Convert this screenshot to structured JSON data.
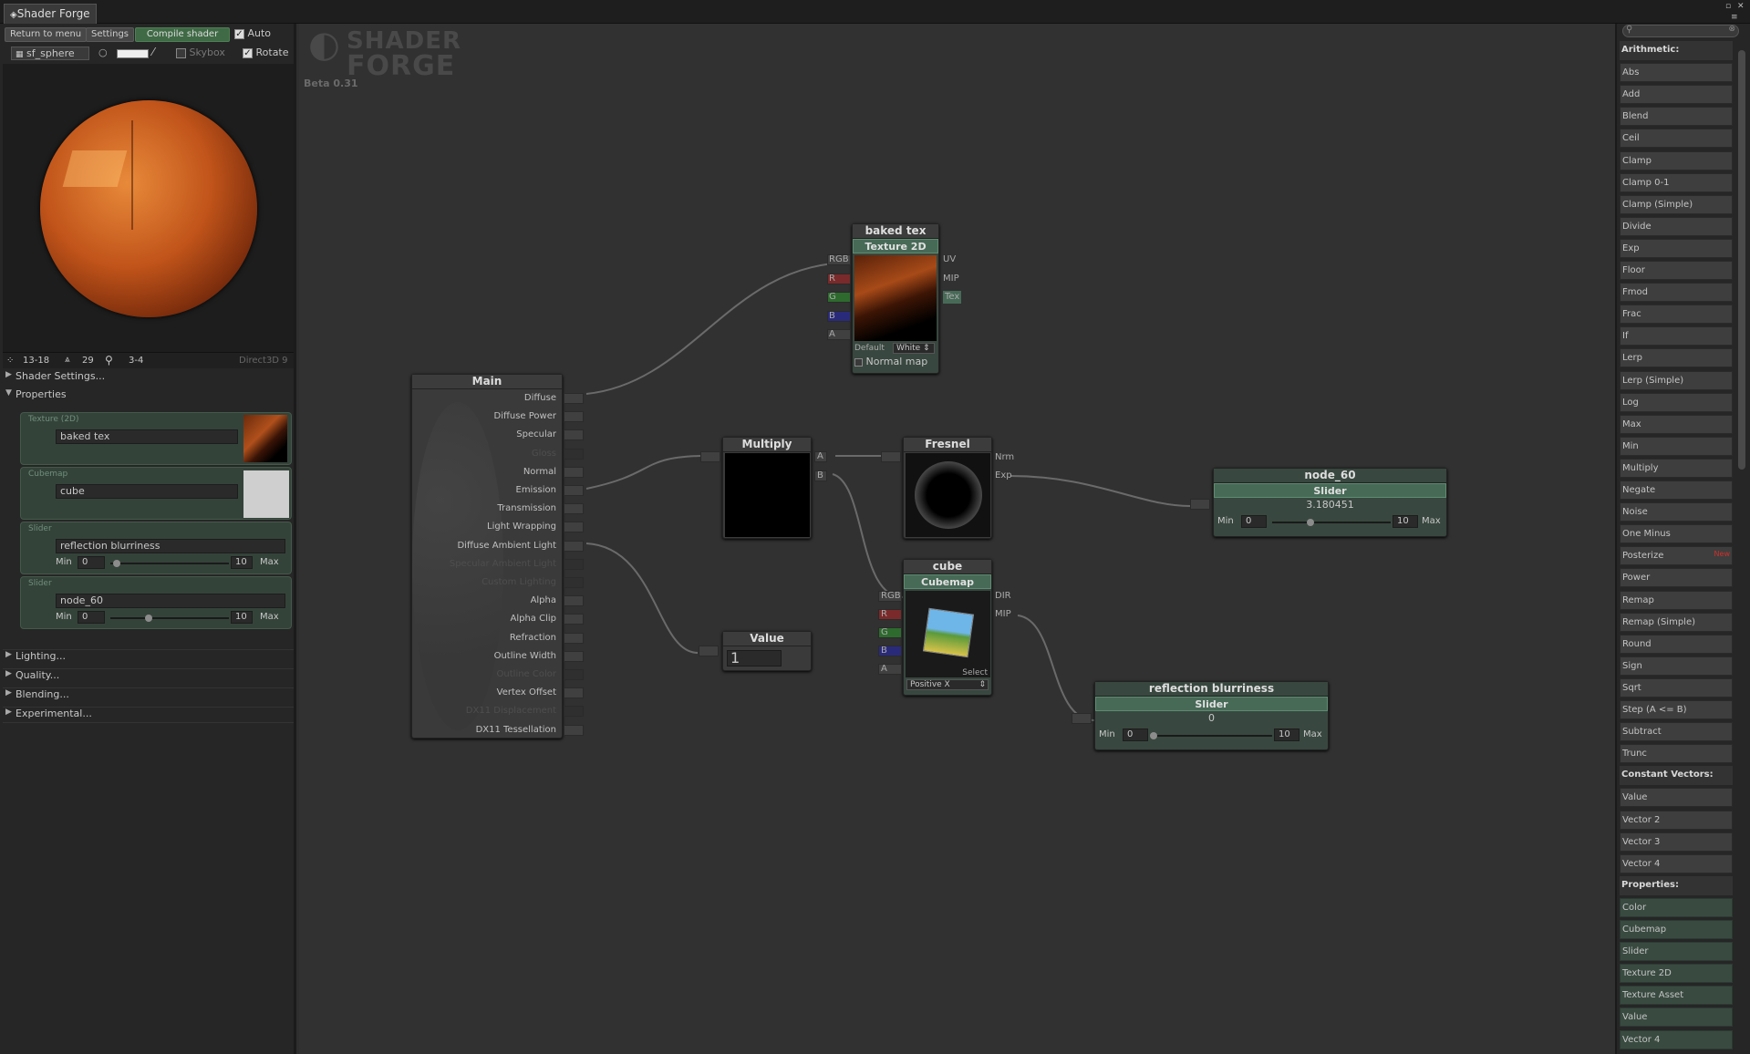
{
  "window": {
    "title": "Shader Forge"
  },
  "toolbar": {
    "return_label": "Return to menu",
    "settings_label": "Settings",
    "compile_label": "Compile shader",
    "auto_label": "Auto",
    "mesh_label": "sf_sphere",
    "skybox_label": "Skybox",
    "rotate_label": "Rotate"
  },
  "stats": {
    "verts": "13-18",
    "tris": "29",
    "passes": "3-4",
    "renderer": "Direct3D 9"
  },
  "left_sections": {
    "shader_settings": "Shader Settings...",
    "properties": "Properties",
    "lighting": "Lighting...",
    "quality": "Quality...",
    "blending": "Blending...",
    "experimental": "Experimental..."
  },
  "properties": [
    {
      "type": "Texture (2D)",
      "name": "baked tex"
    },
    {
      "type": "Cubemap",
      "name": "cube"
    },
    {
      "type": "Slider",
      "name": "reflection blurriness",
      "min_label": "Min",
      "min": "0",
      "max": "10",
      "max_label": "Max",
      "position": 0.05
    },
    {
      "type": "Slider",
      "name": "node_60",
      "min_label": "Min",
      "min": "0",
      "max": "10",
      "max_label": "Max",
      "position": 0.32
    }
  ],
  "logo": {
    "line1": "SHADER",
    "line2": "FORGE",
    "version": "Beta 0.31"
  },
  "main_node": {
    "title": "Main",
    "inputs": [
      "Diffuse",
      "Diffuse Power",
      "Specular",
      "Gloss",
      "Normal",
      "Emission",
      "Transmission",
      "Light Wrapping",
      "Diffuse Ambient Light",
      "Specular Ambient Light",
      "Custom Lighting",
      "Alpha",
      "Alpha Clip",
      "Refraction",
      "Outline Width",
      "Outline Color",
      "Vertex Offset",
      "DX11 Displacement",
      "DX11 Tessellation"
    ],
    "disabled": [
      "Gloss",
      "Specular Ambient Light",
      "Custom Lighting",
      "Outline Color",
      "DX11 Displacement"
    ]
  },
  "baked_tex_node": {
    "title": "baked tex",
    "subtitle": "Texture 2D",
    "outputs": [
      "RGB",
      "R",
      "G",
      "B",
      "A"
    ],
    "inputs": [
      "UV",
      "MIP",
      "Tex"
    ],
    "default_label": "Default",
    "default_value": "White",
    "normal_map_label": "Normal map"
  },
  "multiply_node": {
    "title": "Multiply",
    "inputs": [
      "A",
      "B"
    ]
  },
  "fresnel_node": {
    "title": "Fresnel",
    "inputs": [
      "Nrm",
      "Exp"
    ]
  },
  "value_node": {
    "title": "Value",
    "value": "1"
  },
  "cube_node": {
    "title": "cube",
    "subtitle": "Cubemap",
    "outputs": [
      "RGB",
      "R",
      "G",
      "B",
      "A"
    ],
    "inputs": [
      "DIR",
      "MIP"
    ],
    "select_label": "Select",
    "face": "Positive X"
  },
  "node_60": {
    "title": "node_60",
    "subtitle": "Slider",
    "value": "3.180451",
    "min_label": "Min",
    "min": "0",
    "max": "10",
    "max_label": "Max",
    "position": 0.32
  },
  "refl_node": {
    "title": "reflection blurriness",
    "subtitle": "Slider",
    "value": "0",
    "min_label": "Min",
    "min": "0",
    "max": "10",
    "max_label": "Max",
    "position": 0.0
  },
  "node_list": {
    "search_placeholder": "",
    "arithmetic_header": "Arithmetic:",
    "arithmetic": [
      "Abs",
      "Add",
      "Blend",
      "Ceil",
      "Clamp",
      "Clamp 0-1",
      "Clamp (Simple)",
      "Divide",
      "Exp",
      "Floor",
      "Fmod",
      "Frac",
      "If",
      "Lerp",
      "Lerp (Simple)",
      "Log",
      "Max",
      "Min",
      "Multiply",
      "Negate",
      "Noise",
      "One Minus",
      "Posterize",
      "Power",
      "Remap",
      "Remap (Simple)",
      "Round",
      "Sign",
      "Sqrt",
      "Step (A <= B)",
      "Subtract",
      "Trunc"
    ],
    "new_badge": "New",
    "constant_header": "Constant Vectors:",
    "constant": [
      "Value",
      "Vector 2",
      "Vector 3",
      "Vector 4"
    ],
    "properties_header": "Properties:",
    "properties": [
      "Color",
      "Cubemap",
      "Slider",
      "Texture 2D",
      "Texture Asset",
      "Value",
      "Vector 4"
    ]
  },
  "colors": {
    "accent_green": "#476a57",
    "prop_bg": "#34433a",
    "canvas": "#313131"
  }
}
